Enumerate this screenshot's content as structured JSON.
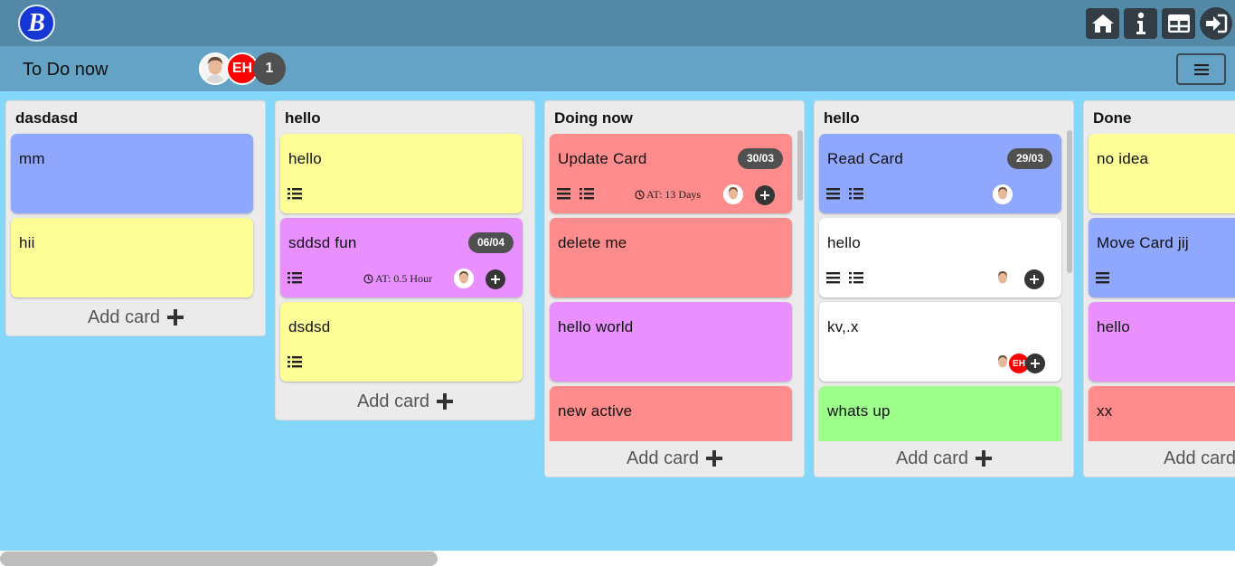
{
  "app": {
    "logo_letter": "B"
  },
  "header": {
    "icons": [
      "home-icon",
      "info-icon",
      "dashboard-icon",
      "sign-in-icon"
    ]
  },
  "board": {
    "title": "To Do now",
    "members": [
      {
        "type": "photo",
        "name": "avatar"
      },
      {
        "type": "initials",
        "text": "EH",
        "color": "#ff0000"
      },
      {
        "type": "count",
        "text": "1",
        "color": "#505050"
      }
    ]
  },
  "lists": [
    {
      "title": "dasdasd",
      "add_label": "Add card",
      "cards": [
        {
          "title": "mm",
          "color": "#8fa7fd"
        },
        {
          "title": "hii",
          "color": "#fdfe96"
        }
      ]
    },
    {
      "title": "hello",
      "add_label": "Add card",
      "cards": [
        {
          "title": "hello",
          "color": "#fdfe96",
          "has_checklist": true
        },
        {
          "title": "sddsd fun",
          "color": "#e98fff",
          "date": "06/04",
          "at": "AT: 0.5 Hour",
          "has_desc": true,
          "has_checklist": true,
          "avatar": true,
          "add": true
        },
        {
          "title": "dsdsd",
          "color": "#fdfe96",
          "has_checklist": true
        }
      ]
    },
    {
      "title": "Doing now",
      "add_label": "Add card",
      "cards": [
        {
          "title": "Update Card",
          "color": "#ff8c8c",
          "date": "30/03",
          "at": "AT: 13 Days",
          "has_desc": true,
          "has_checklist": true,
          "avatar": true,
          "add": true
        },
        {
          "title": "delete me",
          "color": "#ff8c8c"
        },
        {
          "title": "hello world",
          "color": "#e98fff"
        },
        {
          "title": "new active",
          "color": "#ff8c8c"
        }
      ]
    },
    {
      "title": "hello",
      "add_label": "Add card",
      "cards": [
        {
          "title": "Read Card",
          "color": "#8fa7fd",
          "date": "29/03",
          "has_desc": true,
          "has_checklist": true,
          "avatar": true
        },
        {
          "title": "hello",
          "color": "#ffffff",
          "has_desc": true,
          "has_checklist": true,
          "avatar": true,
          "add": true
        },
        {
          "title": "kv,.x",
          "color": "#ffffff",
          "avatar": true,
          "eh": "EH",
          "add": true
        },
        {
          "title": "whats up",
          "color": "#9dfe8c"
        }
      ]
    },
    {
      "title": "Done",
      "add_label": "Add card",
      "cards": [
        {
          "title": "no idea",
          "color": "#fdfe96"
        },
        {
          "title": "Move Card jij",
          "color": "#8fa7fd",
          "has_desc": true
        },
        {
          "title": "hello",
          "color": "#e98fff"
        },
        {
          "title": "xx",
          "color": "#ff8c8c"
        }
      ]
    }
  ]
}
